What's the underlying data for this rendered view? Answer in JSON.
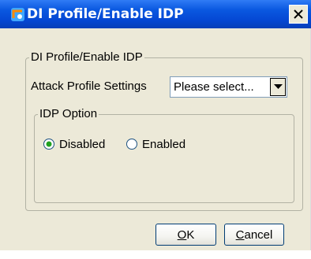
{
  "window": {
    "title": "DI Profile/Enable IDP",
    "icon": "app-icon",
    "close_icon": "close-icon"
  },
  "main_group": {
    "legend": "DI Profile/Enable IDP",
    "attack_profile": {
      "label": "Attack Profile Settings",
      "value": "Please select...",
      "dropdown_icon": "chevron-down-icon"
    },
    "idp_option": {
      "legend": "IDP Option",
      "selected": "Disabled",
      "options": [
        {
          "label": "Disabled",
          "checked": true
        },
        {
          "label": "Enabled",
          "checked": false
        }
      ]
    }
  },
  "buttons": {
    "ok_mnemonic": "O",
    "ok_rest": "K",
    "cancel_mnemonic": "C",
    "cancel_rest": "ancel"
  },
  "colors": {
    "titlebar": "#0548d4",
    "dialog_bg": "#ece9d8",
    "radio_selected": "#21a121",
    "button_border": "#003c74"
  }
}
